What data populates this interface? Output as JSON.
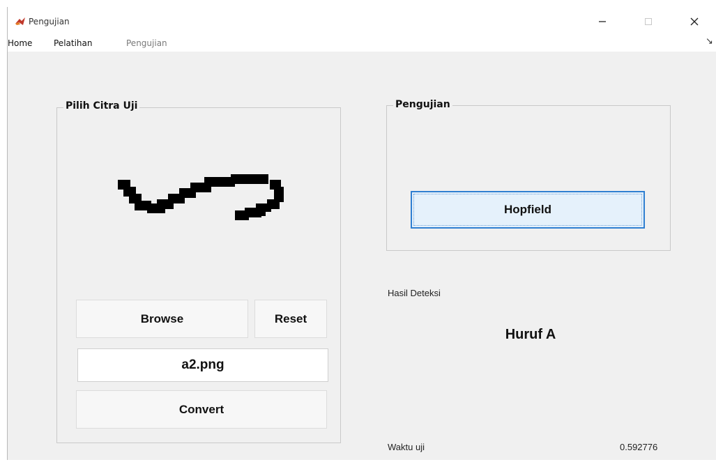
{
  "window": {
    "title": "Pengujian"
  },
  "menu": {
    "items": [
      "Home",
      "Pelatihan",
      "Pengujian"
    ]
  },
  "left_panel": {
    "title": "Pilih Citra Uji",
    "browse_label": "Browse",
    "reset_label": "Reset",
    "filename": "a2.png",
    "convert_label": "Convert"
  },
  "right_panel": {
    "title": "Pengujian",
    "hopfield_label": "Hopfield",
    "result_caption": "Hasil Deteksi",
    "result_value": "Huruf A",
    "time_caption": "Waktu uji",
    "time_value": "0.592776"
  },
  "colors": {
    "window_bg": "#f0f0f0",
    "focus_border": "#2f7fd1",
    "focus_fill": "#e5f1fb"
  }
}
